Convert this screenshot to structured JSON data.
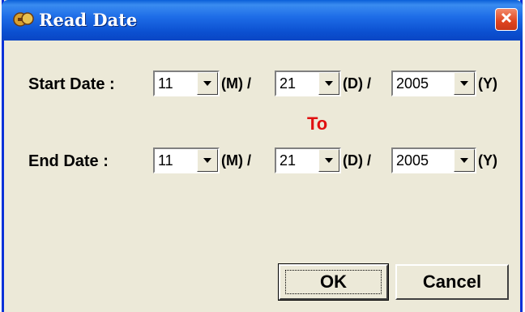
{
  "window": {
    "title": "Read Date",
    "icon": "app-icon",
    "close_icon": "close-icon"
  },
  "start": {
    "label": "Start Date :",
    "month": "11",
    "day": "21",
    "year": "2005"
  },
  "separator": "To",
  "end": {
    "label": "End Date :",
    "month": "11",
    "day": "21",
    "year": "2005"
  },
  "units": {
    "month": "(M) /",
    "day": "(D) /",
    "year": "(Y)"
  },
  "buttons": {
    "ok": "OK",
    "cancel": "Cancel"
  },
  "colors": {
    "title_bar": "#0b4fd0",
    "to_text": "#e01010",
    "dialog_bg": "#ece9d8"
  }
}
